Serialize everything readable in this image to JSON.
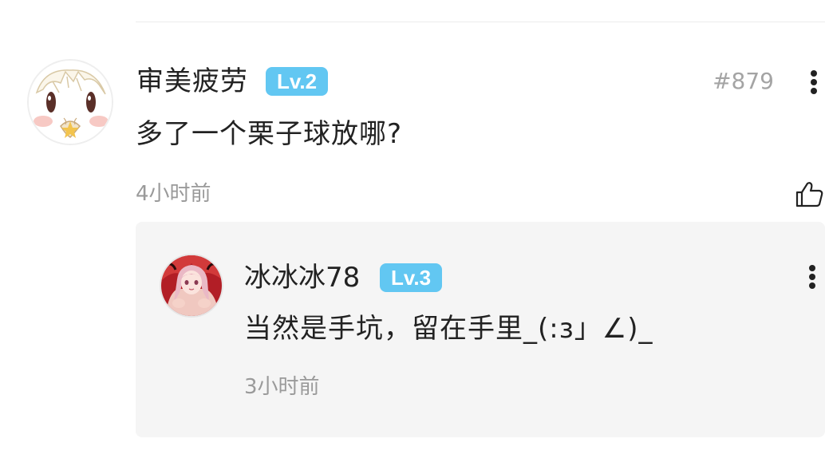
{
  "comment": {
    "username": "审美疲劳",
    "level": "Lv.2",
    "floor": "#879",
    "text": "多了一个栗子球放哪?",
    "time": "4小时前",
    "avatar_icon": "cartoon-face-avatar",
    "more_icon": "vertical-ellipsis-icon",
    "like_icon": "thumbs-up-icon"
  },
  "reply": {
    "username": "冰冰冰78",
    "level": "Lv.3",
    "text": "当然是手坑，留在手里_(:з」∠)_",
    "time": "3小时前",
    "avatar_icon": "anime-girl-avatar",
    "more_icon": "vertical-ellipsis-icon"
  },
  "colors": {
    "level_badge": "#62c7f2",
    "primary_text": "#222222",
    "secondary_text": "#9a9a9a",
    "reply_background": "#f5f5f5"
  }
}
